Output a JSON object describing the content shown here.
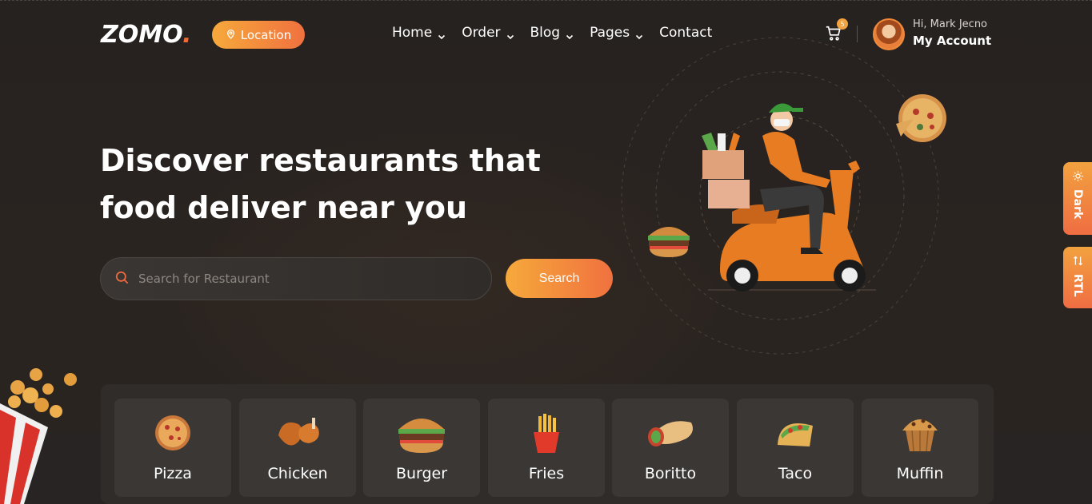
{
  "brand": {
    "logo": "ZOMO",
    "logo_dot": "."
  },
  "header": {
    "location_label": "Location",
    "nav": [
      {
        "label": "Home",
        "has_dropdown": true
      },
      {
        "label": "Order",
        "has_dropdown": true
      },
      {
        "label": "Blog",
        "has_dropdown": true
      },
      {
        "label": "Pages",
        "has_dropdown": true
      },
      {
        "label": "Contact",
        "has_dropdown": false
      }
    ],
    "cart_count": "5",
    "greeting": "Hi, Mark Jecno",
    "account_label": "My Account"
  },
  "hero": {
    "headline": "Discover restaurants that food deliver near you",
    "search_placeholder": "Search for Restaurant",
    "search_button": "Search"
  },
  "side_toggles": {
    "dark_label": "Dark",
    "rtl_label": "RTL"
  },
  "categories": [
    {
      "label": "Pizza",
      "icon": "pizza-icon"
    },
    {
      "label": "Chicken",
      "icon": "chicken-icon"
    },
    {
      "label": "Burger",
      "icon": "burger-icon"
    },
    {
      "label": "Fries",
      "icon": "fries-icon"
    },
    {
      "label": "Boritto",
      "icon": "burrito-icon"
    },
    {
      "label": "Taco",
      "icon": "taco-icon"
    },
    {
      "label": "Muffin",
      "icon": "muffin-icon"
    }
  ],
  "colors": {
    "accent_start": "#f6a93b",
    "accent_end": "#f0713f",
    "background": "#272320",
    "card": "#3a3735"
  }
}
